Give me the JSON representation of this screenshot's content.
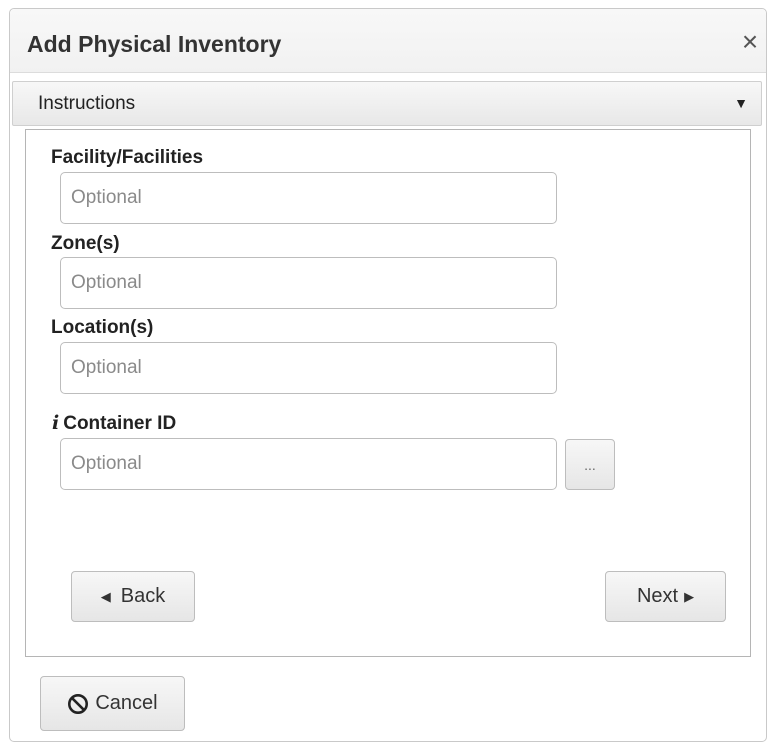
{
  "dialog": {
    "title": "Add Physical Inventory",
    "close_symbol": "×",
    "close_icon": "close-icon"
  },
  "instructions": {
    "label": "Instructions",
    "caret": "▼",
    "caret_icon": "caret-down-icon"
  },
  "fields": [
    {
      "label": "Facility/Facilities",
      "placeholder": "Optional",
      "value": ""
    },
    {
      "label": "Zone(s)",
      "placeholder": "Optional",
      "value": ""
    },
    {
      "label": "Location(s)",
      "placeholder": "Optional",
      "value": ""
    },
    {
      "label": "Container ID",
      "placeholder": "Optional",
      "value": "",
      "info_symbol": "i",
      "info_icon": "info-icon"
    }
  ],
  "browse_button": {
    "label": "..."
  },
  "nav": {
    "back_label": "Back",
    "back_arrow": "◀",
    "next_label": "Next",
    "next_arrow": "▶"
  },
  "cancel": {
    "label": "Cancel",
    "icon": "cancel-icon"
  }
}
